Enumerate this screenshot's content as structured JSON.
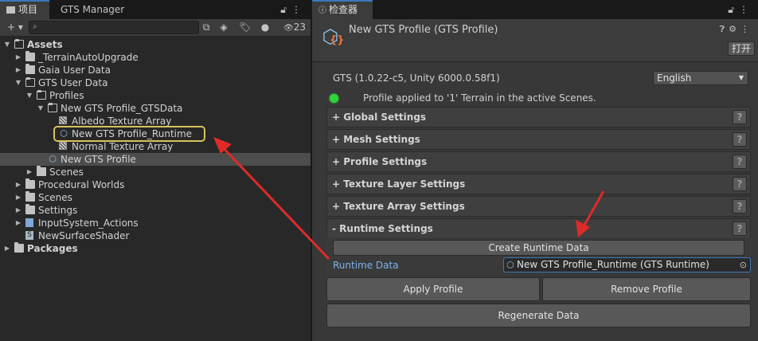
{
  "left_panel": {
    "tabs": [
      {
        "label": "项目",
        "icon": "folder-icon"
      },
      {
        "label": "GTS Manager"
      }
    ],
    "tab_icons": [
      "lock-icon",
      "kebab-menu-icon"
    ],
    "toolbar": {
      "add_label": "+ ▾",
      "search_placeholder": "",
      "hidden_count": "23"
    },
    "tree": [
      {
        "label": "Assets",
        "depth": 0,
        "expanded": true,
        "icon": "folder-open",
        "bold": true
      },
      {
        "label": "_TerrainAutoUpgrade",
        "depth": 1,
        "expanded": false,
        "icon": "folder"
      },
      {
        "label": "Gaia User Data",
        "depth": 1,
        "expanded": false,
        "icon": "folder"
      },
      {
        "label": "GTS User Data",
        "depth": 1,
        "expanded": true,
        "icon": "folder-open"
      },
      {
        "label": "Profiles",
        "depth": 2,
        "expanded": true,
        "icon": "folder-open"
      },
      {
        "label": "New GTS Profile_GTSData",
        "depth": 3,
        "expanded": true,
        "icon": "folder-open"
      },
      {
        "label": "Albedo Texture Array",
        "depth": 4,
        "icon": "texture-array"
      },
      {
        "label": "New GTS Profile_Runtime",
        "depth": 4,
        "icon": "gts-runtime",
        "highlighted": true
      },
      {
        "label": "Normal Texture Array",
        "depth": 4,
        "icon": "texture-array"
      },
      {
        "label": "New GTS Profile",
        "depth": 3,
        "icon": "gts-profile",
        "selected": true
      },
      {
        "label": "Scenes",
        "depth": 2,
        "expanded": false,
        "icon": "folder"
      },
      {
        "label": "Procedural Worlds",
        "depth": 1,
        "expanded": false,
        "icon": "folder"
      },
      {
        "label": "Scenes",
        "depth": 1,
        "expanded": false,
        "icon": "folder"
      },
      {
        "label": "Settings",
        "depth": 1,
        "expanded": false,
        "icon": "folder"
      },
      {
        "label": "InputSystem_Actions",
        "depth": 1,
        "expanded": false,
        "icon": "input-actions"
      },
      {
        "label": "NewSurfaceShader",
        "depth": 1,
        "icon": "shader"
      },
      {
        "label": "Packages",
        "depth": 0,
        "expanded": false,
        "icon": "folder",
        "bold": true
      }
    ]
  },
  "inspector": {
    "tab_label": "检查器",
    "tab_icon": "info-icon",
    "title": "New GTS Profile (GTS Profile)",
    "open_label": "打开",
    "version": "GTS (1.0.22-c5, Unity 6000.0.58f1)",
    "language": "English",
    "status": "Profile applied to '1' Terrain in the active Scenes.",
    "status_color": "#2fd43a",
    "sections": [
      {
        "label": "+ Global Settings"
      },
      {
        "label": "+ Mesh Settings"
      },
      {
        "label": "+ Profile Settings"
      },
      {
        "label": "+ Texture Layer Settings"
      },
      {
        "label": "+ Texture Array Settings"
      },
      {
        "label": "- Runtime Settings"
      }
    ],
    "help_label": "?",
    "create_runtime_label": "Create Runtime Data",
    "runtime_data_label": "Runtime Data",
    "runtime_data_value": "New GTS Profile_Runtime (GTS Runtime)",
    "apply_label": "Apply Profile",
    "remove_label": "Remove Profile",
    "regenerate_label": "Regenerate Data"
  },
  "colors": {
    "accent": "#3a79bb",
    "highlight_outline": "#d8c25c",
    "annotation_arrow": "#e02a2a"
  }
}
